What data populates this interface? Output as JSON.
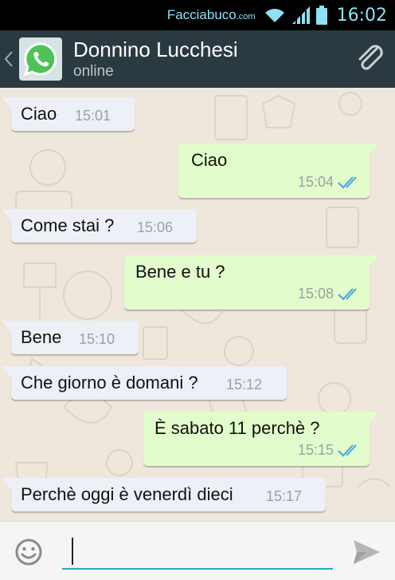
{
  "status_bar": {
    "watermark_main": "Facciabuco",
    "watermark_suffix": ".com",
    "time": "16:02"
  },
  "header": {
    "contact_name": "Donnino Lucchesi",
    "contact_status": "online"
  },
  "messages": [
    {
      "direction": "in",
      "text": "Ciao",
      "time": "15:01"
    },
    {
      "direction": "out",
      "text": "Ciao",
      "time": "15:04",
      "status": "read"
    },
    {
      "direction": "in",
      "text": "Come stai ?",
      "time": "15:06"
    },
    {
      "direction": "out",
      "text": "Bene e tu ?",
      "time": "15:08",
      "status": "read"
    },
    {
      "direction": "in",
      "text": "Bene",
      "time": "15:10"
    },
    {
      "direction": "in",
      "text": "Che giorno è domani ?",
      "time": "15:12"
    },
    {
      "direction": "out",
      "text": "È sabato 11 perchè ?",
      "time": "15:15",
      "status": "read"
    },
    {
      "direction": "in",
      "text": "Perchè oggi è venerdì dieci",
      "time": "15:17"
    }
  ],
  "composer": {
    "value": "",
    "placeholder": ""
  },
  "colors": {
    "header_bg": "#2b3a40",
    "incoming_bubble": "#eef0f8",
    "outgoing_bubble": "#e3fccb",
    "read_ticks": "#3fa7dd",
    "input_underline": "#2aa7c6"
  }
}
